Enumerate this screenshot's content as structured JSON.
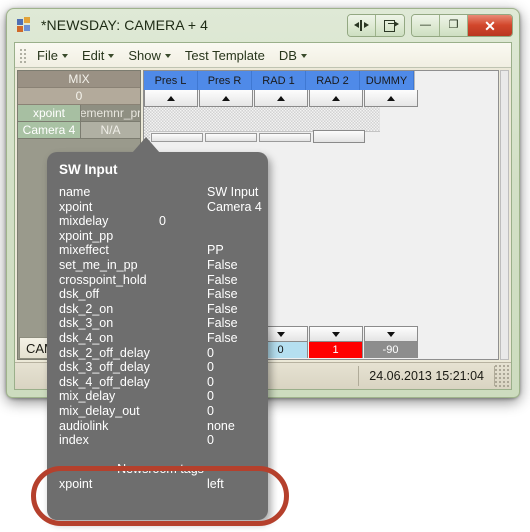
{
  "window": {
    "title": "*NEWSDAY: CAMERA + 4",
    "caption_buttons": [
      {
        "name": "resize-button",
        "glyph": ""
      },
      {
        "name": "export-button",
        "glyph": ""
      },
      {
        "name": "minimize-button",
        "glyph": "—"
      },
      {
        "name": "maximize-button",
        "glyph": "❐"
      },
      {
        "name": "close-button",
        "glyph": "✕"
      }
    ]
  },
  "menubar": {
    "items": [
      {
        "label": "File",
        "caret": true
      },
      {
        "label": "Edit",
        "caret": true
      },
      {
        "label": "Show",
        "caret": true
      },
      {
        "label": "Test Template",
        "caret": false
      },
      {
        "label": "DB",
        "caret": true
      }
    ]
  },
  "left_panel": {
    "mix_header": "MIX",
    "mix_value": "0",
    "row1": {
      "left": "xpoint",
      "right": "ememnr_pr"
    },
    "row2": {
      "left": "Camera 4",
      "right": "N/A"
    },
    "cam_button": "CAM"
  },
  "grid": {
    "columns": [
      "Pres L",
      "Pres R",
      "RAD 1",
      "RAD 2",
      "DUMMY"
    ],
    "bottom_values": [
      {
        "text": "0",
        "bg": "#b5dff0",
        "fg": "#111111"
      },
      {
        "text": "1",
        "bg": "#ff0000",
        "fg": "#ffffff"
      },
      {
        "text": "-90",
        "bg": "#8d8d8d",
        "fg": "#ffffff"
      }
    ]
  },
  "statusbar": {
    "timestamp": "24.06.2013 15:21:04"
  },
  "tooltip": {
    "title": "SW Input",
    "rows": [
      {
        "key": "name",
        "mid": "",
        "value": "SW Input"
      },
      {
        "key": "xpoint",
        "mid": "",
        "value": "Camera 4"
      },
      {
        "key": "mixdelay",
        "mid": "0",
        "value": ""
      },
      {
        "key": "xpoint_pp",
        "mid": "",
        "value": ""
      },
      {
        "key": "mixeffect",
        "mid": "",
        "value": "PP"
      },
      {
        "key": "set_me_in_pp",
        "mid": "",
        "value": "False"
      },
      {
        "key": "crosspoint_hold",
        "mid": "",
        "value": "False"
      },
      {
        "key": "dsk_off",
        "mid": "",
        "value": "False"
      },
      {
        "key": "dsk_2_on",
        "mid": "",
        "value": "False"
      },
      {
        "key": "dsk_3_on",
        "mid": "",
        "value": "False"
      },
      {
        "key": "dsk_4_on",
        "mid": "",
        "value": "False"
      },
      {
        "key": "dsk_2_off_delay",
        "mid": "",
        "value": "0"
      },
      {
        "key": "dsk_3_off_delay",
        "mid": "",
        "value": "0"
      },
      {
        "key": "dsk_4_off_delay",
        "mid": "",
        "value": "0"
      },
      {
        "key": "mix_delay",
        "mid": "",
        "value": "0"
      },
      {
        "key": "mix_delay_out",
        "mid": "",
        "value": "0"
      },
      {
        "key": "audiolink",
        "mid": "",
        "value": "none"
      },
      {
        "key": "index",
        "mid": "",
        "value": "0"
      }
    ],
    "section_label": "-- Newsroom tags --",
    "section_rows": [
      {
        "key": "xpoint",
        "mid": "",
        "value": "left"
      }
    ]
  },
  "annotation": {
    "color": "#b5402c",
    "shape": "ellipse-highlight"
  }
}
